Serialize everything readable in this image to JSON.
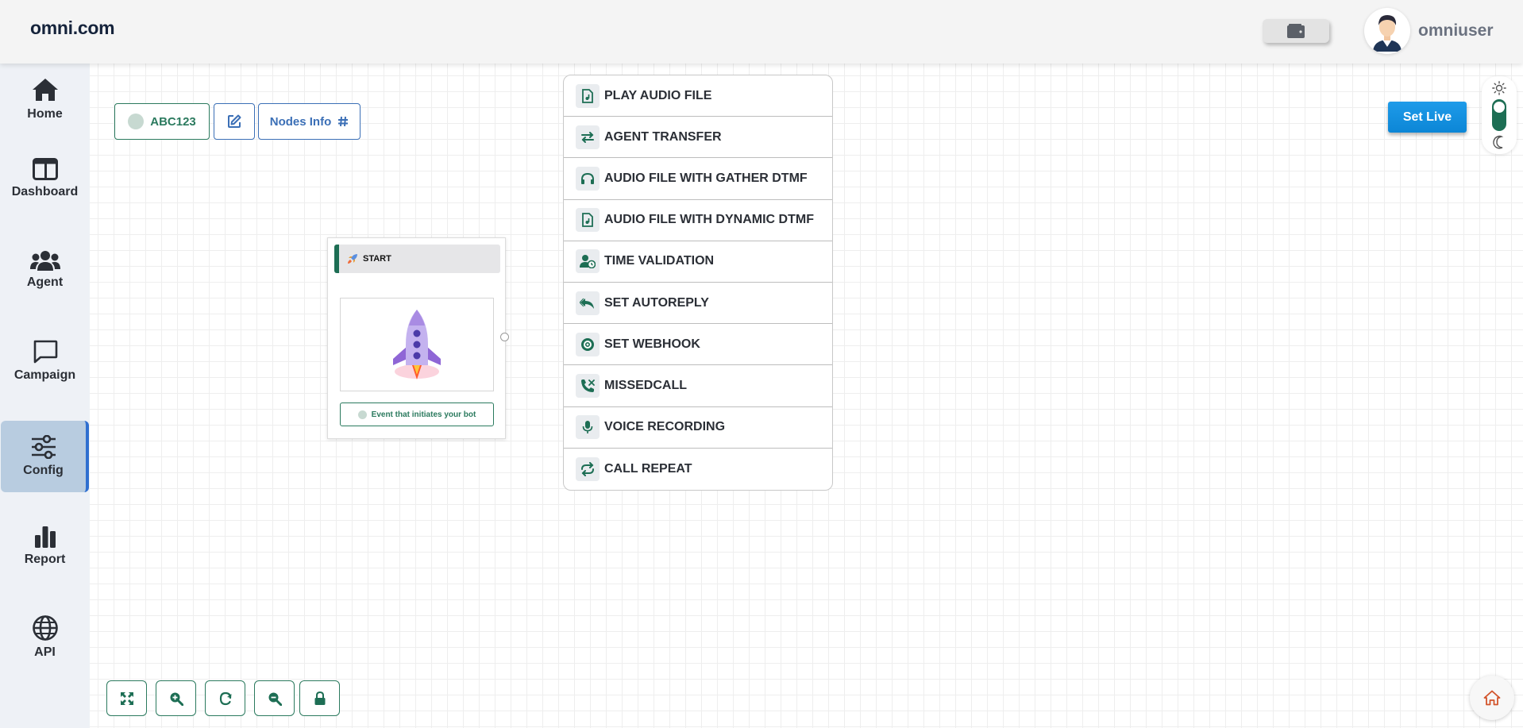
{
  "header": {
    "brand": "omni.com",
    "username": "omniuser"
  },
  "sidebar": {
    "items": [
      {
        "label": "Home",
        "icon": "home-icon"
      },
      {
        "label": "Dashboard",
        "icon": "dashboard-icon"
      },
      {
        "label": "Agent",
        "icon": "users-icon"
      },
      {
        "label": "Campaign",
        "icon": "chat-icon"
      },
      {
        "label": "Config",
        "icon": "sliders-icon",
        "active": true
      },
      {
        "label": "Report",
        "icon": "bar-chart-icon"
      },
      {
        "label": "API",
        "icon": "globe-icon"
      }
    ]
  },
  "toolbar": {
    "flow_name": "ABC123",
    "nodes_info_label": "Nodes Info"
  },
  "start_node": {
    "title": "START",
    "event_label": "Event that initiates your bot"
  },
  "node_menu": {
    "items": [
      {
        "label": "PLAY AUDIO FILE",
        "icon": "audio-file-icon"
      },
      {
        "label": "AGENT TRANSFER",
        "icon": "transfer-icon"
      },
      {
        "label": "AUDIO FILE WITH GATHER DTMF",
        "icon": "headphones-icon"
      },
      {
        "label": "AUDIO FILE WITH DYNAMIC DTMF",
        "icon": "audio-file-icon"
      },
      {
        "label": "TIME VALIDATION",
        "icon": "user-clock-icon"
      },
      {
        "label": "SET AUTOREPLY",
        "icon": "reply-all-icon"
      },
      {
        "label": "SET WEBHOOK",
        "icon": "webhook-icon"
      },
      {
        "label": "MISSEDCALL",
        "icon": "missed-call-icon"
      },
      {
        "label": "VOICE RECORDING",
        "icon": "microphone-icon"
      },
      {
        "label": "CALL REPEAT",
        "icon": "repeat-icon"
      }
    ]
  },
  "actions": {
    "set_live_label": "Set Live"
  },
  "colors": {
    "primary_green": "#1d6e54",
    "accent_blue": "#0c86d6",
    "sidebar_active": "#b8cce0"
  }
}
